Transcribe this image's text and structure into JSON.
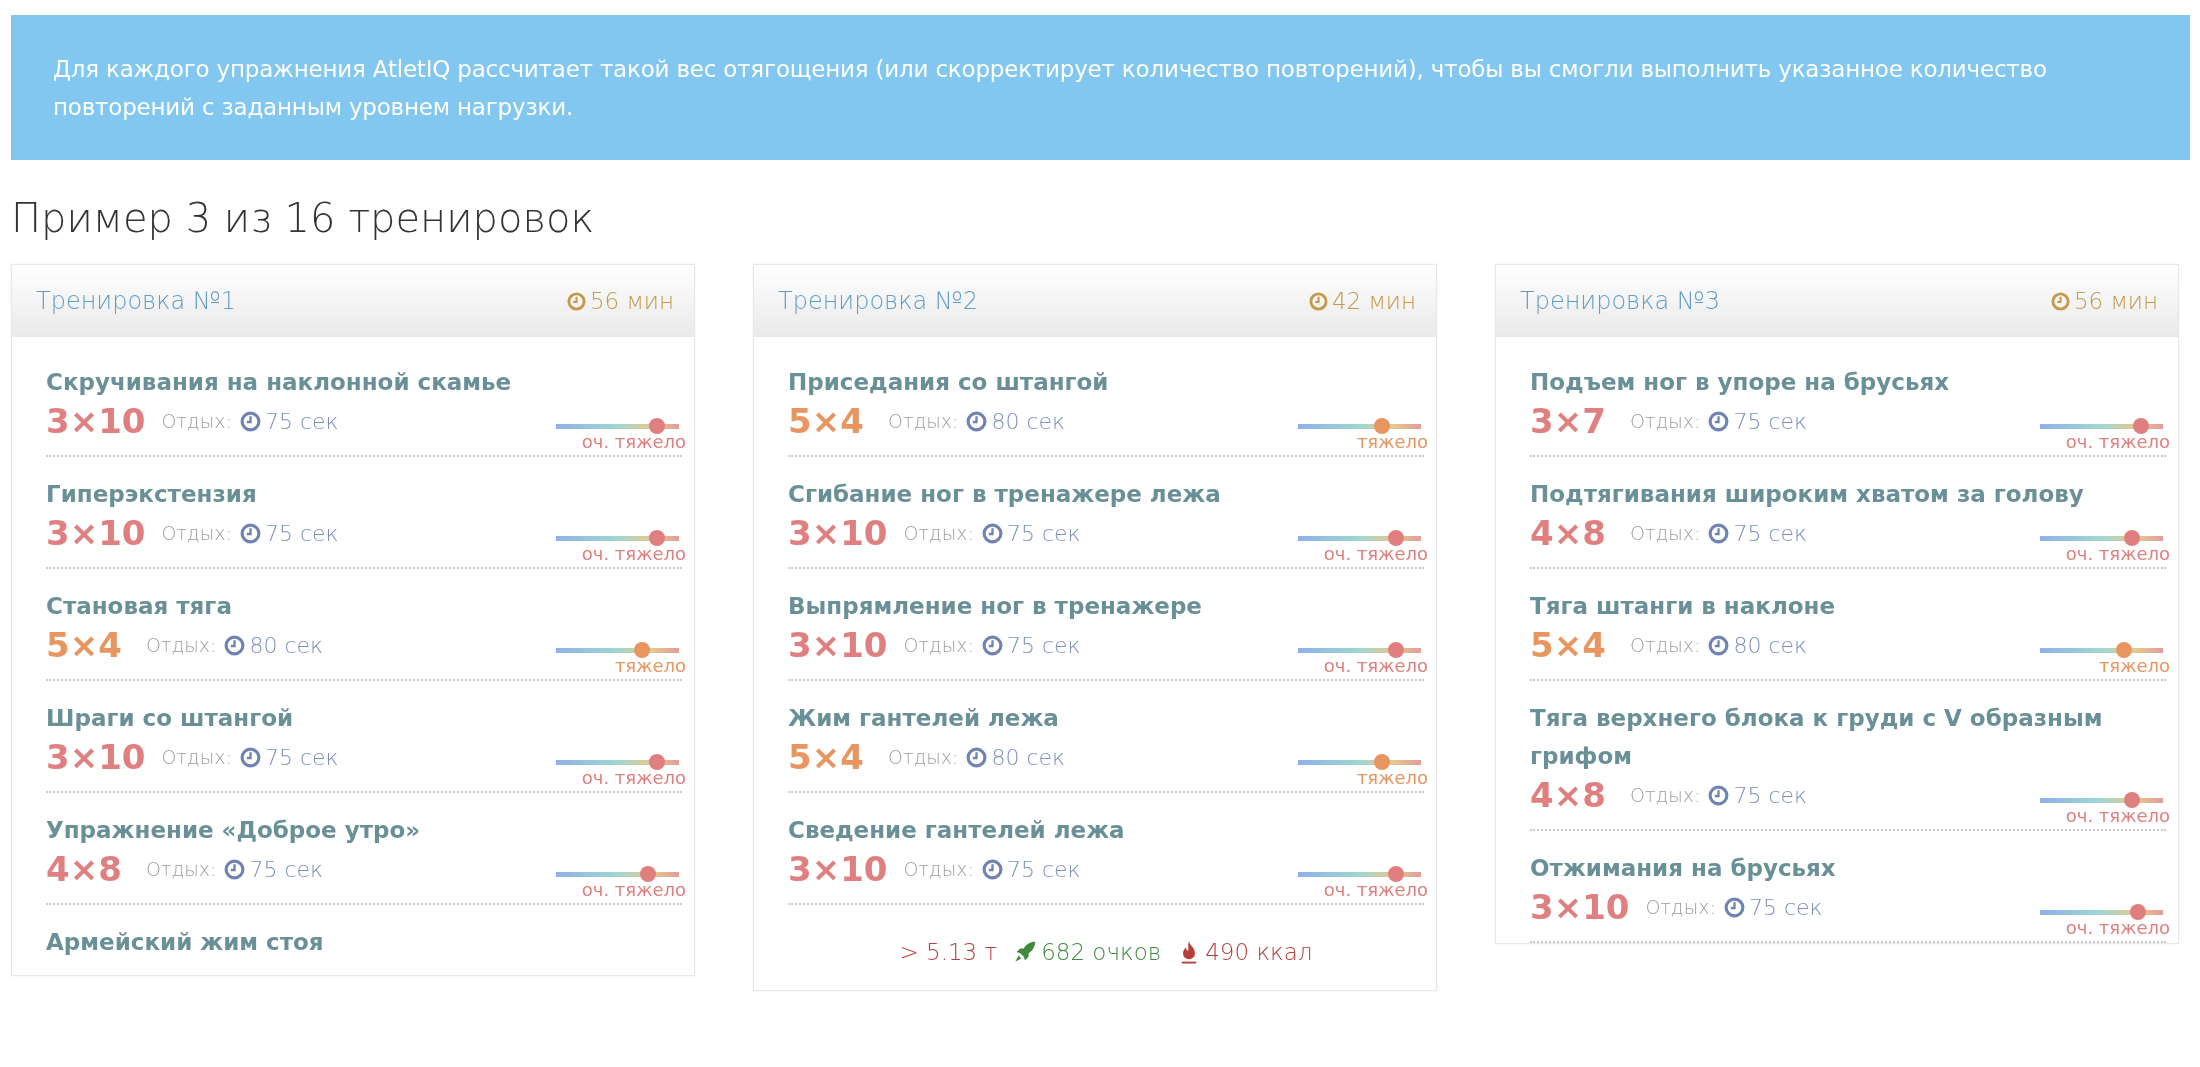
{
  "notice": "Для каждого упражнения AtletIQ рассчитает такой вес отягощения (или скорректирует количество повторений), чтобы вы смогли выполнить указанное количество повторений с заданным уровнем нагрузки.",
  "heading": "Пример 3 из 16 тренировок",
  "workouts": [
    {
      "title": "Тренировка №1",
      "duration": "56 мин",
      "exercises": [
        {
          "name": "Скручивания на наклонной скамье",
          "sets": "3×10",
          "rest_label": "Отдых:",
          "rest": "75 сек",
          "level": 0.82,
          "intensity": "оч. тяжело",
          "color": "#e07f7f"
        },
        {
          "name": "Гиперэкстензия",
          "sets": "3×10",
          "rest_label": "Отдых:",
          "rest": "75 сек",
          "level": 0.82,
          "intensity": "оч. тяжело",
          "color": "#e07f7f"
        },
        {
          "name": "Становая тяга",
          "sets": "5×4",
          "rest_label": "Отдых:",
          "rest": "80 сек",
          "level": 0.7,
          "intensity": "тяжело",
          "color": "#e8955f"
        },
        {
          "name": "Шраги со штангой",
          "sets": "3×10",
          "rest_label": "Отдых:",
          "rest": "75 сек",
          "level": 0.82,
          "intensity": "оч. тяжело",
          "color": "#e07f7f"
        },
        {
          "name": "Упражнение «Доброе утро»",
          "sets": "4×8",
          "rest_label": "Отдых:",
          "rest": "75 сек",
          "level": 0.75,
          "intensity": "оч. тяжело",
          "color": "#e07f7f"
        },
        {
          "name": "Армейский жим стоя"
        }
      ]
    },
    {
      "title": "Тренировка №2",
      "duration": "42 мин",
      "exercises": [
        {
          "name": "Приседания со штангой",
          "sets": "5×4",
          "rest_label": "Отдых:",
          "rest": "80 сек",
          "level": 0.68,
          "intensity": "тяжело",
          "color": "#e8955f"
        },
        {
          "name": "Сгибание ног в тренажере лежа",
          "sets": "3×10",
          "rest_label": "Отдых:",
          "rest": "75 сек",
          "level": 0.8,
          "intensity": "оч. тяжело",
          "color": "#e07f7f"
        },
        {
          "name": "Выпрямление ног в тренажере",
          "sets": "3×10",
          "rest_label": "Отдых:",
          "rest": "75 сек",
          "level": 0.8,
          "intensity": "оч. тяжело",
          "color": "#e07f7f"
        },
        {
          "name": "Жим гантелей лежа",
          "sets": "5×4",
          "rest_label": "Отдых:",
          "rest": "80 сек",
          "level": 0.68,
          "intensity": "тяжело",
          "color": "#e8955f"
        },
        {
          "name": "Сведение гантелей лежа",
          "sets": "3×10",
          "rest_label": "Отдых:",
          "rest": "75 сек",
          "level": 0.8,
          "intensity": "оч. тяжело",
          "color": "#e07f7f"
        }
      ],
      "totals": {
        "weight": "> 5.13 т",
        "points": "682 очков",
        "calories": "490 ккал"
      }
    },
    {
      "title": "Тренировка №3",
      "duration": "56 мин",
      "exercises": [
        {
          "name": "Подъем ног в упоре на брусьях",
          "sets": "3×7",
          "rest_label": "Отдых:",
          "rest": "75 сек",
          "level": 0.82,
          "intensity": "оч. тяжело",
          "color": "#e07f7f"
        },
        {
          "name": "Подтягивания широким хватом за голову",
          "sets": "4×8",
          "rest_label": "Отдых:",
          "rest": "75 сек",
          "level": 0.75,
          "intensity": "оч. тяжело",
          "color": "#e07f7f"
        },
        {
          "name": "Тяга штанги в наклоне",
          "sets": "5×4",
          "rest_label": "Отдых:",
          "rest": "80 сек",
          "level": 0.68,
          "intensity": "тяжело",
          "color": "#e8955f"
        },
        {
          "name": "Тяга верхнего блока к груди с V образным грифом",
          "sets": "4×8",
          "rest_label": "Отдых:",
          "rest": "75 сек",
          "level": 0.75,
          "intensity": "оч. тяжело",
          "color": "#e07f7f"
        },
        {
          "name": "Отжимания на брусьях",
          "sets": "3×10",
          "rest_label": "Отдых:",
          "rest": "75 сек",
          "level": 0.8,
          "intensity": "оч. тяжело",
          "color": "#e07f7f"
        }
      ]
    }
  ]
}
